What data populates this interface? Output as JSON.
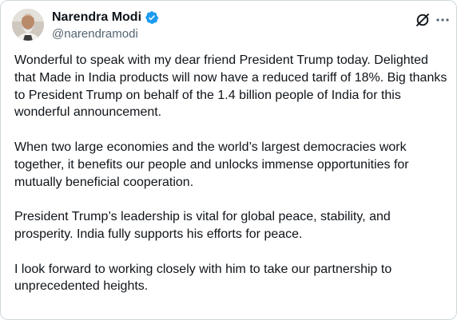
{
  "author": {
    "display_name": "Narendra Modi",
    "handle": "@narendramodi",
    "verified": true,
    "avatar_icon": "profile-photo"
  },
  "header_actions": {
    "grok_icon": "grok-icon",
    "more_icon": "more-icon"
  },
  "tweet": {
    "paragraphs": [
      "Wonderful to speak with my dear friend President Trump today. Delighted that Made in India products will now have a reduced tariff of 18%. Big thanks to President Trump on behalf of the 1.4 billion people of India for this wonderful announcement.",
      "When two large economies and the world’s largest democracies work together, it benefits our people and unlocks immense opportunities for mutually beneficial cooperation.",
      "President Trump’s leadership is vital for global peace, stability, and prosperity. India fully supports his efforts for peace.",
      "I look forward to working closely with him to take our partnership to unprecedented heights."
    ]
  },
  "colors": {
    "text": "#0f1419",
    "secondary_text": "#536471",
    "verified_badge": "#1d9bf0",
    "border": "#cfd9de"
  }
}
